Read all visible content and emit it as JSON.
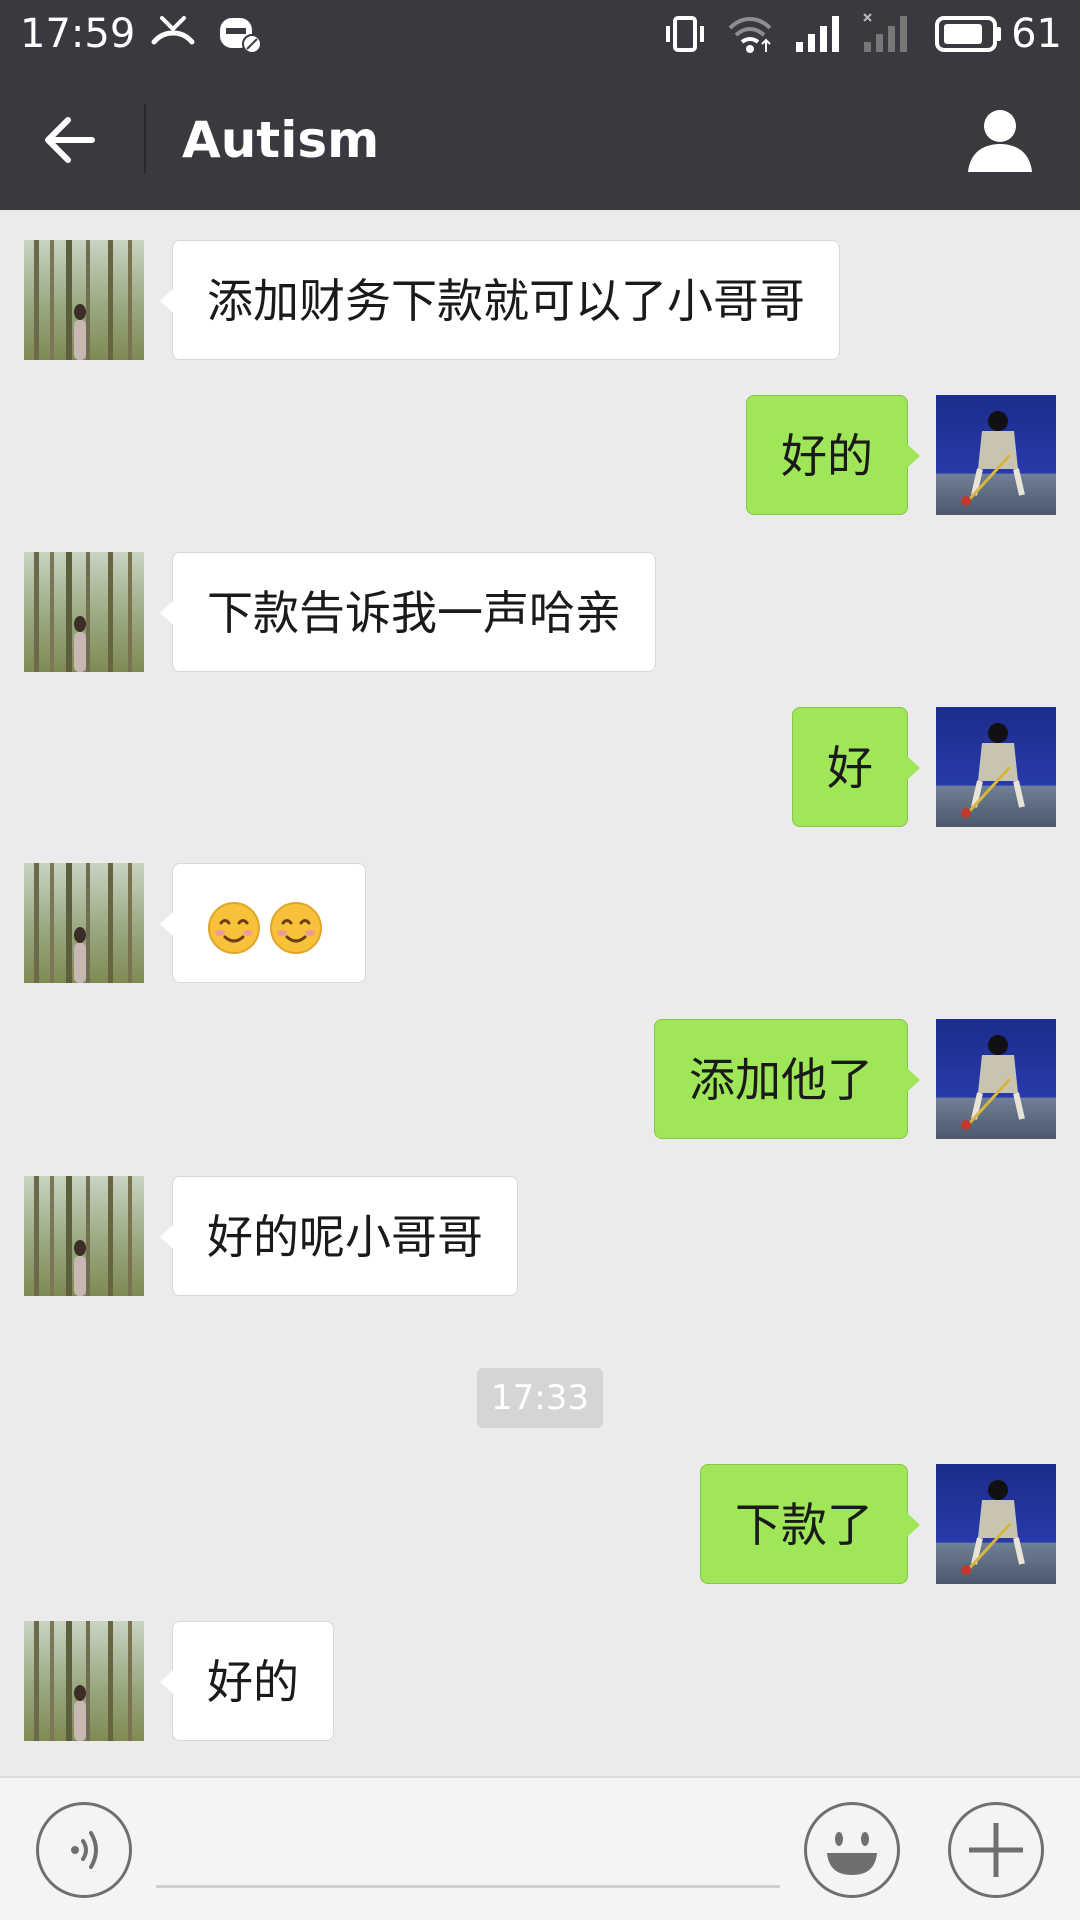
{
  "status_bar": {
    "time": "17:59",
    "battery": "61",
    "icons": [
      "missed-call-icon",
      "do-not-disturb-icon",
      "vibrate-icon",
      "wifi-icon",
      "signal-icon",
      "signal-empty-icon",
      "battery-icon"
    ]
  },
  "header": {
    "title": "Autism",
    "back_icon": "back-arrow-icon",
    "profile_icon": "profile-icon"
  },
  "messages": [
    {
      "side": "left",
      "text": "添加财务下款就可以了小哥哥"
    },
    {
      "side": "right",
      "text": "好的"
    },
    {
      "side": "left",
      "text": "下款告诉我一声哈亲"
    },
    {
      "side": "right",
      "text": "好"
    },
    {
      "side": "left",
      "emoji": [
        "smile-blush-emoji",
        "smile-blush-emoji"
      ]
    },
    {
      "side": "right",
      "text": "添加他了"
    },
    {
      "side": "left",
      "text": "好的呢小哥哥"
    },
    {
      "timestamp": "17:33"
    },
    {
      "side": "right",
      "text": "下款了"
    },
    {
      "side": "left",
      "text": "好的"
    }
  ],
  "input_bar": {
    "voice_icon": "voice-icon",
    "emoji_icon": "emoji-icon",
    "plus_icon": "plus-icon",
    "input_value": ""
  },
  "colors": {
    "header_bg": "#393a3f",
    "chat_bg": "#ebebeb",
    "sent_bubble": "#9fe658",
    "received_bubble": "#ffffff"
  }
}
